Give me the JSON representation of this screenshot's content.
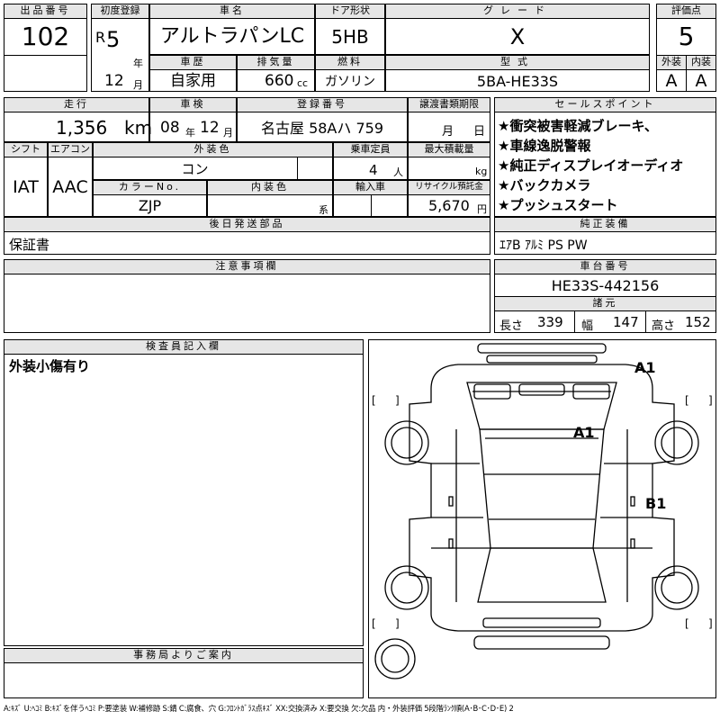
{
  "header": {
    "lot_no_label": "出品番号",
    "lot_no": "102",
    "first_reg_label": "初度登録",
    "era": "R",
    "reg_year": "5",
    "year_suffix": "年",
    "reg_month": "12",
    "month_suffix": "月",
    "car_name_label": "車名",
    "car_name": "アルトラパンLC",
    "door_label": "ドア形状",
    "door": "5HB",
    "grade_label": "グレード",
    "grade": "X",
    "score_label": "評価点",
    "score": "5",
    "history_label": "車歴",
    "history": "自家用",
    "displacement_label": "排気量",
    "displacement": "660",
    "displacement_unit": "cc",
    "fuel_label": "燃料",
    "fuel": "ガソリン",
    "model_label": "型式",
    "model": "5BA-HE33S",
    "exterior_label": "外装",
    "exterior": "A",
    "interior_label": "内装",
    "interior": "A"
  },
  "row2": {
    "mileage_label": "走行",
    "mileage": "1,356",
    "mileage_unit": "km",
    "inspection_label": "車検",
    "insp_year": "08",
    "insp_year_suffix": "年",
    "insp_month": "12",
    "insp_month_suffix": "月",
    "plate_label": "登録番号",
    "plate": "名古屋 58Aハ 759",
    "transfer_label": "譲渡書類期限",
    "transfer_month": "月",
    "transfer_day": "日",
    "shift_label": "シフト",
    "shift": "IAT",
    "ac_label": "エアコン",
    "ac": "AAC",
    "color_label": "外装色",
    "color": "コン",
    "capacity_label": "乗車定員",
    "capacity": "4",
    "capacity_unit": "人",
    "load_label": "最大積載量",
    "load_unit": "kg",
    "color_no_label": "カラーNo.",
    "color_no": "ZJP",
    "interior_color_label": "内装色",
    "interior_color_suffix": "系",
    "import_label": "輸入車",
    "recycle_label": "リサイクル預託金",
    "recycle": "5,670",
    "recycle_unit": "円"
  },
  "sales_points": {
    "label": "セールスポイント",
    "items": [
      "★衝突被害軽減ブレーキ、",
      "★車線逸脱警報",
      "★純正ディスプレイオーディオ",
      "★バックカメラ",
      "★プッシュスタート"
    ]
  },
  "parts": {
    "label": "後日発送部品",
    "value": "保証書"
  },
  "equipment": {
    "label": "純正装備",
    "value": "ｴｱB ｱﾙﾐ PS PW"
  },
  "notes": {
    "label": "注意事項欄"
  },
  "chassis": {
    "label": "車台番号",
    "value": "HE33S-442156",
    "spec_label": "諸元",
    "length_label": "長さ",
    "length": "339",
    "width_label": "幅",
    "width": "147",
    "height_label": "高さ",
    "height": "152"
  },
  "inspector": {
    "label": "検査員記入欄",
    "text": "外装小傷有り"
  },
  "office": {
    "label": "事務局よりご案内"
  },
  "damage_marks": [
    "A1",
    "A1",
    "B1"
  ],
  "legend": "A:ｷｽﾞ U:ﾍｺﾐ B:ｷｽﾞを伴うﾍｺﾐ P:要塗装 W:補修跡 S:錆 C:腐食、穴 G:ﾌﾛﾝﾄｶﾞﾗｽ点ｷｽﾞ XX:交換済み X:要交換 欠:欠品 内・外装評価 5段階ﾗﾝｸ順(A･B･C･D･E) 2"
}
